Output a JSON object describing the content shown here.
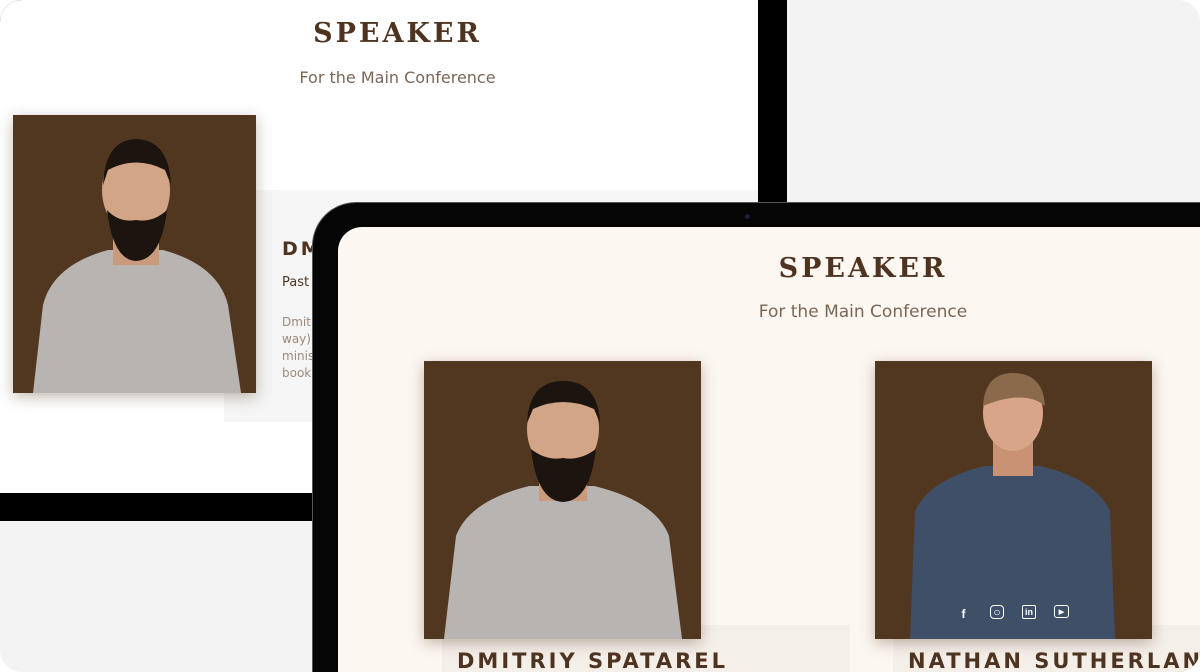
{
  "laptop": {
    "title": "SPEAKER",
    "subtitle": "For the Main Conference",
    "speaker": {
      "name_partial": "DM",
      "role_partial": "Past",
      "bio_lines": [
        "Dmit",
        "way),",
        "minis",
        "book"
      ]
    }
  },
  "tablet": {
    "title": "SPEAKER",
    "subtitle": "For the Main Conference",
    "speakers": [
      {
        "name": "DMITRIY SPATAREL"
      },
      {
        "name": "NATHAN SUTHERLAND",
        "social": [
          "facebook-icon",
          "instagram-icon",
          "linkedin-icon",
          "youtube-icon"
        ]
      }
    ]
  },
  "colors": {
    "brand_brown": "#4e3420",
    "photo_bg": "#523720",
    "tablet_bg": "#fdf7f1"
  }
}
